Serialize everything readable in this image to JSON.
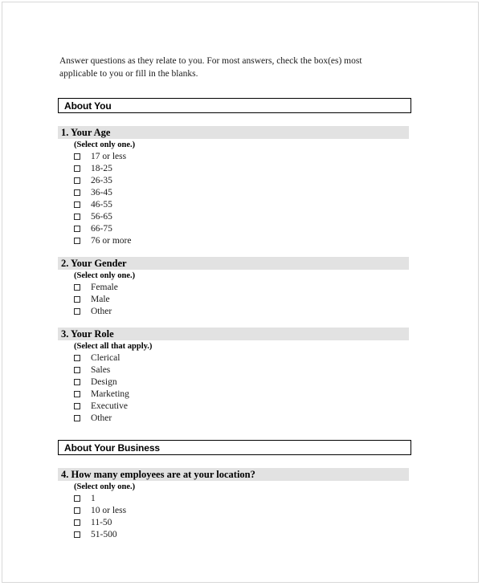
{
  "document": {
    "intro": "Answer questions as they relate to you. For most answers, check the box(es) most applicable to you or fill in the blanks.",
    "colors": {
      "question_band": "#e2e2e2",
      "section_border": "#000000",
      "page_border": "#d8d8d8",
      "text": "#1a1a1a"
    }
  },
  "sections": [
    {
      "title": "About You",
      "questions": [
        {
          "number": "1.",
          "title": "1. Your Age",
          "hint": "(Select only one.)",
          "select_mode": "one",
          "options": [
            "17 or less",
            "18-25",
            "26-35",
            "36-45",
            "46-55",
            "56-65",
            "66-75",
            "76 or more"
          ]
        },
        {
          "number": "2.",
          "title": "2. Your Gender",
          "hint": "(Select only one.)",
          "select_mode": "one",
          "options": [
            "Female",
            "Male",
            "Other"
          ]
        },
        {
          "number": "3.",
          "title": "3. Your Role",
          "hint": "(Select all that apply.)",
          "select_mode": "all",
          "options": [
            "Clerical",
            "Sales",
            "Design",
            "Marketing",
            "Executive",
            "Other"
          ]
        }
      ]
    },
    {
      "title": "About Your Business",
      "questions": [
        {
          "number": "4.",
          "title": "4. How many employees are at your location?",
          "hint": "(Select only one.)",
          "select_mode": "one",
          "options": [
            "1",
            "10 or less",
            "11-50",
            "51-500"
          ]
        }
      ]
    }
  ]
}
